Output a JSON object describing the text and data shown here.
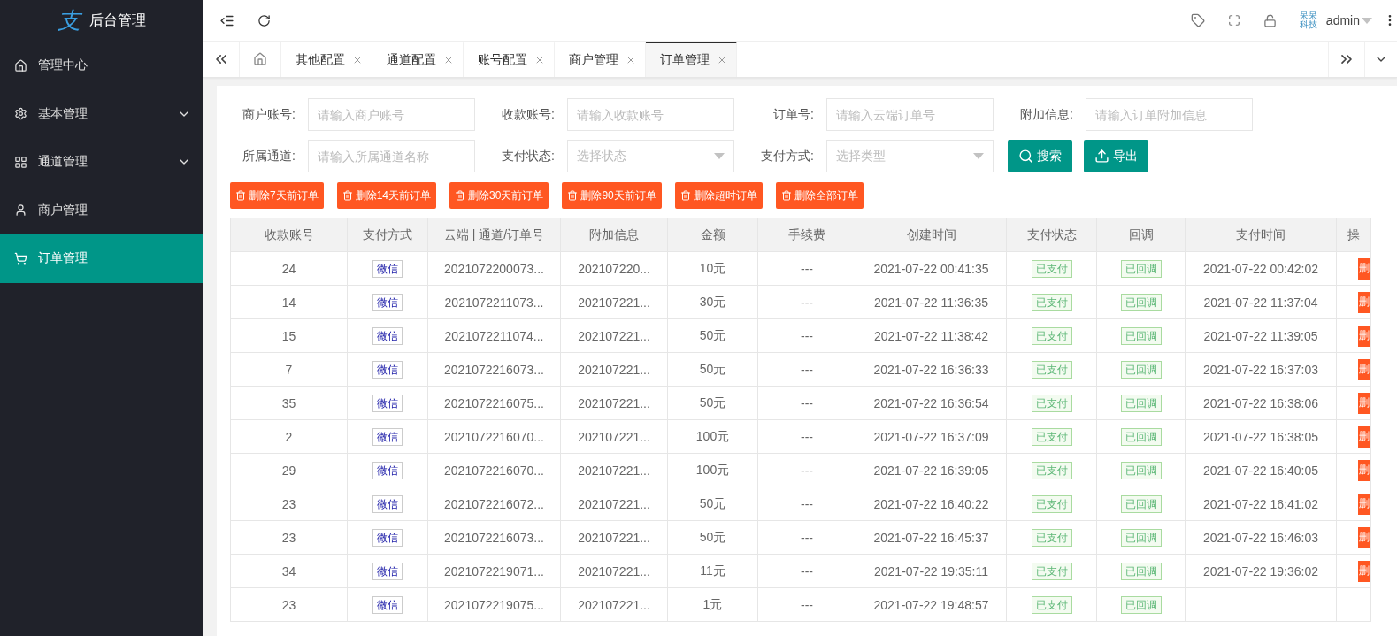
{
  "sidebar": {
    "logo_mark": "支",
    "title": "后台管理",
    "items": [
      {
        "label": "管理中心",
        "has_submenu": false,
        "selected": false
      },
      {
        "label": "基本管理",
        "has_submenu": true,
        "selected": false
      },
      {
        "label": "通道管理",
        "has_submenu": true,
        "selected": false
      },
      {
        "label": "商户管理",
        "has_submenu": false,
        "selected": false
      },
      {
        "label": "订单管理",
        "has_submenu": false,
        "selected": true
      }
    ]
  },
  "header": {
    "brand": "呆呆科技",
    "user": "admin"
  },
  "tabs": [
    {
      "label": "其他配置",
      "selected": false
    },
    {
      "label": "通道配置",
      "selected": false
    },
    {
      "label": "账号配置",
      "selected": false
    },
    {
      "label": "商户管理",
      "selected": false
    },
    {
      "label": "订单管理",
      "selected": true
    }
  ],
  "filters": [
    {
      "label": "商户账号:",
      "kind": "input",
      "placeholder": "请输入商户账号"
    },
    {
      "label": "收款账号:",
      "kind": "input",
      "placeholder": "请输入收款账号"
    },
    {
      "label": "订单号:",
      "kind": "input",
      "placeholder": "请输入云端订单号"
    },
    {
      "label": "附加信息:",
      "kind": "input",
      "placeholder": "请输入订单附加信息"
    },
    {
      "label": "所属通道:",
      "kind": "input",
      "placeholder": "请输入所属通道名称"
    },
    {
      "label": "支付状态:",
      "kind": "select",
      "placeholder": "选择状态"
    },
    {
      "label": "支付方式:",
      "kind": "select",
      "placeholder": "选择类型"
    }
  ],
  "actions": [
    "搜索",
    "导出"
  ],
  "delete_buttons": [
    "删除7天前订单",
    "删除14天前订单",
    "删除30天前订单",
    "删除90天前订单",
    "删除超时订单",
    "删除全部订单"
  ],
  "table": {
    "columns": [
      "收款账号",
      "支付方式",
      "云端 | 通道/订单号",
      "附加信息",
      "金额",
      "手续费",
      "创建时间",
      "支付状态",
      "回调",
      "支付时间",
      "操"
    ],
    "rows": [
      {
        "account": "24",
        "pay_method": "微信",
        "order_no": "2021072200073...",
        "extra": "202107220...",
        "amount": "10元",
        "fee": "---",
        "created": "2021-07-22 00:41:35",
        "pay_status": "已支付",
        "callback": "已回调",
        "paid_at": "2021-07-22 00:42:02",
        "action": "删"
      },
      {
        "account": "14",
        "pay_method": "微信",
        "order_no": "2021072211073...",
        "extra": "202107221...",
        "amount": "30元",
        "fee": "---",
        "created": "2021-07-22 11:36:35",
        "pay_status": "已支付",
        "callback": "已回调",
        "paid_at": "2021-07-22 11:37:04",
        "action": "删"
      },
      {
        "account": "15",
        "pay_method": "微信",
        "order_no": "2021072211074...",
        "extra": "202107221...",
        "amount": "50元",
        "fee": "---",
        "created": "2021-07-22 11:38:42",
        "pay_status": "已支付",
        "callback": "已回调",
        "paid_at": "2021-07-22 11:39:05",
        "action": "删"
      },
      {
        "account": "7",
        "pay_method": "微信",
        "order_no": "2021072216073...",
        "extra": "202107221...",
        "amount": "50元",
        "fee": "---",
        "created": "2021-07-22 16:36:33",
        "pay_status": "已支付",
        "callback": "已回调",
        "paid_at": "2021-07-22 16:37:03",
        "action": "删"
      },
      {
        "account": "35",
        "pay_method": "微信",
        "order_no": "2021072216075...",
        "extra": "202107221...",
        "amount": "50元",
        "fee": "---",
        "created": "2021-07-22 16:36:54",
        "pay_status": "已支付",
        "callback": "已回调",
        "paid_at": "2021-07-22 16:38:06",
        "action": "删"
      },
      {
        "account": "2",
        "pay_method": "微信",
        "order_no": "2021072216070...",
        "extra": "202107221...",
        "amount": "100元",
        "fee": "---",
        "created": "2021-07-22 16:37:09",
        "pay_status": "已支付",
        "callback": "已回调",
        "paid_at": "2021-07-22 16:38:05",
        "action": "删"
      },
      {
        "account": "29",
        "pay_method": "微信",
        "order_no": "2021072216070...",
        "extra": "202107221...",
        "amount": "100元",
        "fee": "---",
        "created": "2021-07-22 16:39:05",
        "pay_status": "已支付",
        "callback": "已回调",
        "paid_at": "2021-07-22 16:40:05",
        "action": "删"
      },
      {
        "account": "23",
        "pay_method": "微信",
        "order_no": "2021072216072...",
        "extra": "202107221...",
        "amount": "50元",
        "fee": "---",
        "created": "2021-07-22 16:40:22",
        "pay_status": "已支付",
        "callback": "已回调",
        "paid_at": "2021-07-22 16:41:02",
        "action": "删"
      },
      {
        "account": "23",
        "pay_method": "微信",
        "order_no": "2021072216073...",
        "extra": "202107221...",
        "amount": "50元",
        "fee": "---",
        "created": "2021-07-22 16:45:37",
        "pay_status": "已支付",
        "callback": "已回调",
        "paid_at": "2021-07-22 16:46:03",
        "action": "删"
      },
      {
        "account": "34",
        "pay_method": "微信",
        "order_no": "2021072219071...",
        "extra": "202107221...",
        "amount": "11元",
        "fee": "---",
        "created": "2021-07-22 19:35:11",
        "pay_status": "已支付",
        "callback": "已回调",
        "paid_at": "2021-07-22 19:36:02",
        "action": "删"
      },
      {
        "account": "23",
        "pay_method": "微信",
        "order_no": "2021072219075...",
        "extra": "202107221...",
        "amount": "1元",
        "fee": "---",
        "created": "2021-07-22 19:48:57",
        "pay_status": "已支付",
        "callback": "已回调"
      }
    ]
  }
}
